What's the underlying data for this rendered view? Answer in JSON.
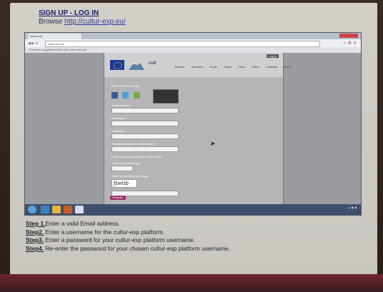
{
  "header": {
    "title": "SIGN UP - LOG IN",
    "browse_label": "Browse",
    "browse_link": "http://cultur-exp.eu/"
  },
  "browser": {
    "tab_label": "cultur-exp",
    "url": "cultur-exp.eu",
    "bookmarks": "Favorites  Suggested Sites  Get more add-ons"
  },
  "site": {
    "login_label": "Log in",
    "logo_text": "cult",
    "menu": [
      "Member",
      "Members",
      "Route",
      "Stage",
      "Photo",
      "Video",
      "Cultivitas",
      "About"
    ],
    "signup_heading": "SIGN UP VIA SOCIAL",
    "thumb_heading": "FEATURED",
    "form_labels": [
      "Email address*",
      "Username*",
      "Password*",
      "Password (again for confirmation)*"
    ],
    "terms_label": "I have read and accept the terms of use",
    "profile_label": "Select your profile type",
    "captcha_prompt": "Enter the text from the image",
    "captcha_text": "Jbetib",
    "register_label": "Register"
  },
  "steps": [
    {
      "label": "Step 1.",
      "text": "Enter a valid Email address."
    },
    {
      "label": "Step2.",
      "text": " Enter a username for the cultur-exp platform."
    },
    {
      "label": "Step3.",
      "text": " Enter a password for your cultur-exp platform username."
    },
    {
      "label": "Step4.",
      "text": " Re-enter the password for your chosen cultur-exp platform username."
    }
  ],
  "colors": {
    "paper": "#ccc9c3",
    "link": "#2d3f9a",
    "taskbar": "#3e4f6e",
    "register": "#a0306a"
  }
}
